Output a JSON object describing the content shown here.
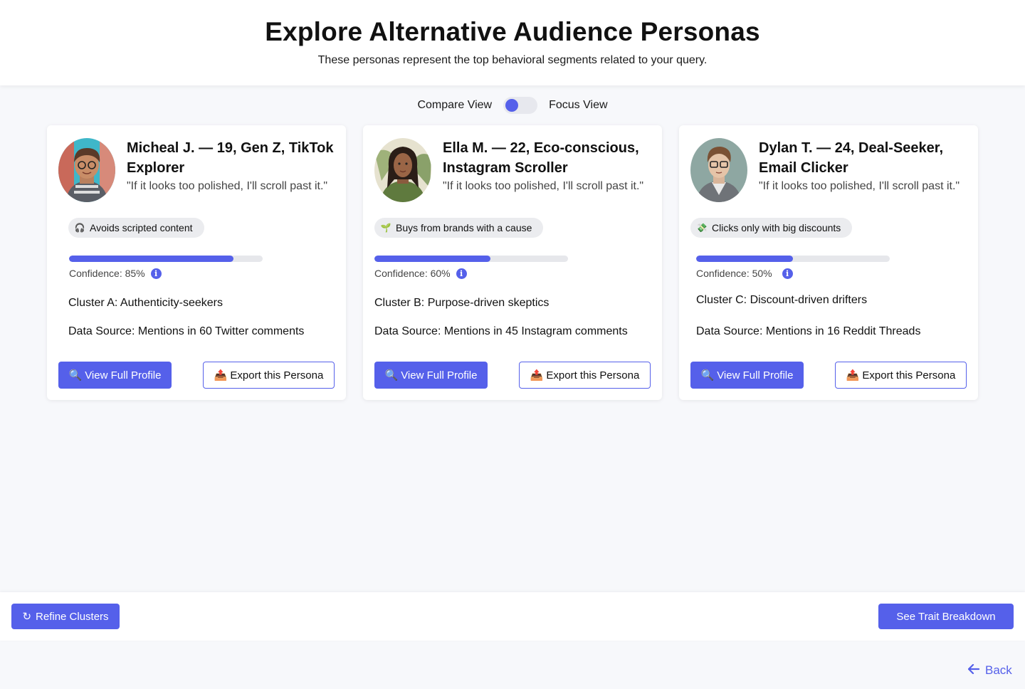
{
  "header": {
    "title": "Explore Alternative Audience Personas",
    "subtitle": "These personas represent the top behavioral segments related to your query."
  },
  "view_toggle": {
    "left_label": "Compare View",
    "right_label": "Focus View"
  },
  "colors": {
    "accent": "#5560ea",
    "background": "#f7f8fb",
    "tag_bg": "#ebecef"
  },
  "personas": [
    {
      "name": "Micheal J. — 19, Gen Z, TikTok Explorer",
      "quote": "\"If it looks too polished, I'll scroll past it.\"",
      "tag_icon": "headphones-icon",
      "tag_glyph": "🎧",
      "tag": "Avoids scripted content",
      "confidence_value": 0.85,
      "confidence_label": "Confidence: 85%",
      "cluster": "Cluster A: Authenticity-seekers",
      "source": "Data Source: Mentions in 60 Twitter comments",
      "view_label": "View Full Profile",
      "export_label": "Export this Persona"
    },
    {
      "name": "Ella M. — 22, Eco-conscious, Instagram Scroller",
      "quote": "\"If it looks too polished, I'll scroll past it.\"",
      "tag_icon": "seedling-icon",
      "tag_glyph": "🌱",
      "tag": "Buys from brands with a cause",
      "confidence_value": 0.6,
      "confidence_label": "Confidence: 60%",
      "cluster": "Cluster B: Purpose-driven skeptics",
      "source": "Data Source: Mentions in 45 Instagram comments",
      "view_label": "View Full Profile",
      "export_label": "Export this Persona"
    },
    {
      "name": "Dylan T. — 24, Deal-Seeker, Email Clicker",
      "quote": "\"If it looks too polished, I'll scroll past it.\"",
      "tag_icon": "money-wings-icon",
      "tag_glyph": "💸",
      "tag": "Clicks only with big discounts",
      "confidence_value": 0.5,
      "confidence_label": "Confidence: 50%",
      "cluster": "Cluster C: Discount-driven drifters",
      "source": "Data Source: Mentions in 16 Reddit Threads",
      "view_label": "View Full Profile",
      "export_label": "Export this Persona"
    }
  ],
  "footer": {
    "refine_label": "Refine Clusters",
    "trait_label": "See Trait Breakdown"
  },
  "back_label": "Back"
}
